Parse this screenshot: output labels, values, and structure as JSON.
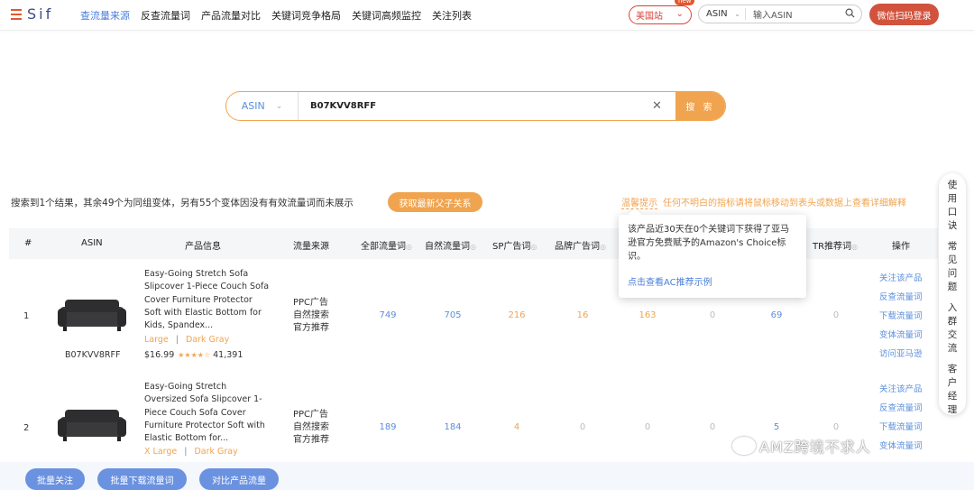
{
  "app": {
    "logo_text": "Sif"
  },
  "nav": {
    "items": [
      "查流量来源",
      "反查流量词",
      "产品流量对比",
      "关键词竞争格局",
      "关键词高频监控",
      "关注列表"
    ]
  },
  "header": {
    "region": "美国站",
    "region_badge": "new",
    "search_type": "ASIN",
    "search_placeholder": "输入ASIN",
    "login_button": "微信扫码登录"
  },
  "main_search": {
    "type": "ASIN",
    "value": "B07KVV8RFF",
    "button": "搜 索"
  },
  "summary": {
    "text": "搜索到1个结果，其余49个为同组变体，另有55个变体因没有有效流量词而未展示",
    "button": "获取最新父子关系",
    "tip_label": "温馨提示",
    "tip_text": "任何不明白的指标请将鼠标移动到表头或数据上查看详细解释"
  },
  "table": {
    "headers": [
      "#",
      "ASIN",
      "产品信息",
      "流量来源",
      "全部流量词",
      "自然流量词",
      "SP广告词",
      "品牌广告词",
      "TR推荐词",
      "操作"
    ],
    "rows": [
      {
        "num": "1",
        "asin": "B07KVV8RFF",
        "title": "Easy-Going Stretch Sofa Slipcover 1-Piece Couch Sofa Cover Furniture Protector Soft with Elastic Bottom for Kids, Spandex...",
        "size": "Large",
        "color": "Dark Gray",
        "price": "$16.99",
        "stars": "★★★★☆",
        "reviews": "41,391",
        "sources": [
          "PPC广告",
          "自然搜索",
          "官方推荐"
        ],
        "all": "749",
        "organic": "705",
        "sp": "216",
        "brand": "16",
        "c5": "163",
        "c6": "0",
        "c7": "69",
        "c8": "0",
        "ops": [
          "关注该产品",
          "反查流量词",
          "下载流量词",
          "变体流量词",
          "访问亚马逊"
        ]
      },
      {
        "num": "2",
        "asin": "",
        "title": "Easy-Going Stretch Oversized Sofa Slipcover 1-Piece Couch Sofa Cover Furniture Protector Soft with Elastic Bottom for...",
        "size": "X Large",
        "color": "Dark Gray",
        "price": "",
        "stars": "",
        "reviews": "",
        "sources": [
          "PPC广告",
          "自然搜索",
          "官方推荐"
        ],
        "all": "189",
        "organic": "184",
        "sp": "4",
        "brand": "0",
        "c5": "0",
        "c6": "0",
        "c7": "5",
        "c8": "0",
        "ops": [
          "关注该产品",
          "反查流量词",
          "下载流量词",
          "变体流量词"
        ]
      }
    ]
  },
  "popover": {
    "text": "该产品近30天在0个关键词下获得了亚马逊官方免费赋予的Amazon's Choice标识。",
    "link": "点击查看AC推荐示例"
  },
  "sidebar": {
    "groups": [
      "使用口诀",
      "常见问题",
      "入群交流",
      "客户经理"
    ]
  },
  "bottom": {
    "buttons": [
      "批量关注",
      "批量下载流量词",
      "对比产品流量"
    ]
  },
  "watermark": "AMZ跨境不求人",
  "colors": {
    "accent": "#f0a44f",
    "brand_red": "#d1533e",
    "link_blue": "#5b8fdc"
  }
}
